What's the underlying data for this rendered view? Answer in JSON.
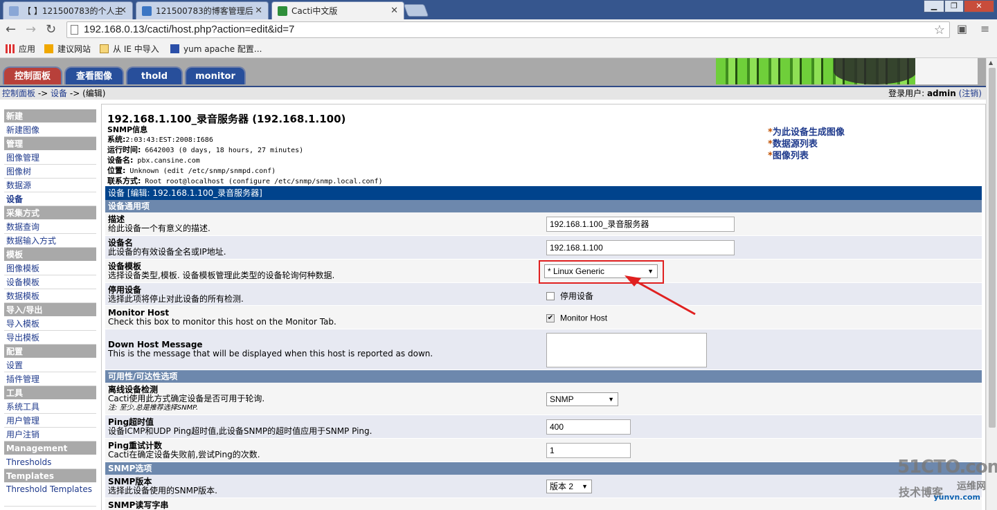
{
  "browser": {
    "tabs": [
      {
        "title": "【 】121500783的个人主",
        "active": false
      },
      {
        "title": "121500783的博客管理后",
        "active": false
      },
      {
        "title": "Cacti中文版",
        "active": true
      }
    ],
    "url": "192.168.0.13/cacti/host.php?action=edit&id=7",
    "bookmarks": [
      "应用",
      "建议网站",
      "从 IE 中导入",
      "yum apache 配置..."
    ]
  },
  "cacti": {
    "tabs": [
      "控制面板",
      "查看图像",
      "thold",
      "monitor"
    ],
    "breadcrumb": {
      "console": "控制面板",
      "sep1": " -> ",
      "devices": "设备",
      "sep2": " -> ",
      "current": "(编辑)"
    },
    "login": {
      "prefix": "登录用户: ",
      "user": "admin",
      "logout": "(注销)"
    }
  },
  "sidebar": [
    {
      "type": "header",
      "label": "新建"
    },
    {
      "type": "item",
      "label": "新建图像"
    },
    {
      "type": "header",
      "label": "管理"
    },
    {
      "type": "item",
      "label": "图像管理"
    },
    {
      "type": "item",
      "label": "图像树"
    },
    {
      "type": "item",
      "label": "数据源"
    },
    {
      "type": "item",
      "label": "设备",
      "current": true
    },
    {
      "type": "header",
      "label": "采集方式"
    },
    {
      "type": "item",
      "label": "数据查询"
    },
    {
      "type": "item",
      "label": "数据输入方式"
    },
    {
      "type": "header",
      "label": "模板"
    },
    {
      "type": "item",
      "label": "图像模板"
    },
    {
      "type": "item",
      "label": "设备模板"
    },
    {
      "type": "item",
      "label": "数据模板"
    },
    {
      "type": "header",
      "label": "导入/导出"
    },
    {
      "type": "item",
      "label": "导入模板"
    },
    {
      "type": "item",
      "label": "导出模板"
    },
    {
      "type": "header",
      "label": "配置"
    },
    {
      "type": "item",
      "label": "设置"
    },
    {
      "type": "item",
      "label": "插件管理"
    },
    {
      "type": "header",
      "label": "工具"
    },
    {
      "type": "item",
      "label": "系统工具"
    },
    {
      "type": "item",
      "label": "用户管理"
    },
    {
      "type": "item",
      "label": "用户注销"
    },
    {
      "type": "header",
      "label": "Management"
    },
    {
      "type": "item",
      "label": "Thresholds"
    },
    {
      "type": "header",
      "label": "Templates"
    },
    {
      "type": "item",
      "label": "Threshold Templates",
      "two_line": true
    }
  ],
  "device": {
    "title": "192.168.1.100_录音服务器 (192.168.1.100)",
    "snmp_info_label": "SNMP信息",
    "system_label": "系统:",
    "system_value": "2:03:43:EST:2008:I686",
    "uptime_label": "运行时间:",
    "uptime_value": " 6642003 (0 days, 18 hours, 27 minutes)",
    "hostname_label": "设备名:",
    "hostname_value": " pbx.cansine.com",
    "location_label": "位置:",
    "location_value": " Unknown (edit /etc/snmp/snmpd.conf)",
    "contact_label": "联系方式:",
    "contact_value": " Root root@localhost (configure /etc/snmp/snmp.local.conf)"
  },
  "quicklinks": [
    "为此设备生成图像",
    "数据源列表",
    "图像列表"
  ],
  "form": {
    "title": "设备 [编辑: 192.168.1.100_录音服务器]",
    "sec_general": "设备通用项",
    "desc_label": "描述",
    "desc_help": "给此设备一个有意义的描述.",
    "desc_value": "192.168.1.100_录音服务器",
    "hostname_label": "设备名",
    "hostname_help": "此设备的有效设备全名或IP地址.",
    "hostname_value": "192.168.1.100",
    "template_label": "设备模板",
    "template_help": "选择设备类型,模板. 设备模板管理此类型的设备轮询何种数据.",
    "template_value": "* Linux Generic",
    "disable_label": "停用设备",
    "disable_help": "选择此项将停止对此设备的所有检测.",
    "disable_check_label": "停用设备",
    "disable_checked": false,
    "monitor_label": "Monitor Host",
    "monitor_help": "Check this box to monitor this host on the Monitor Tab.",
    "monitor_check_label": "Monitor Host",
    "monitor_checked": true,
    "downmsg_label": "Down Host Message",
    "downmsg_help": "This is the message that will be displayed when this host is reported as down.",
    "sec_avail": "可用性/可达性选项",
    "detect_label": "离线设备检测",
    "detect_help": "Cacti使用此方式确定设备是否可用于轮询.",
    "detect_note": "注: 至少,总是推荐选择SNMP.",
    "detect_value": "SNMP",
    "ping_timeout_label": "Ping超时值",
    "ping_timeout_help": "设备ICMP和UDP Ping超时值,此设备SNMP的超时值应用于SNMP Ping.",
    "ping_timeout_value": "400",
    "ping_retry_label": "Ping重试计数",
    "ping_retry_help": "Cacti在确定设备失败前,尝试Ping的次数.",
    "ping_retry_value": "1",
    "sec_snmp": "SNMP选项",
    "snmp_ver_label": "SNMP版本",
    "snmp_ver_help": "选择此设备使用的SNMP版本.",
    "snmp_ver_value": "版本 2",
    "snmp_comm_label": "SNMP读写字串"
  },
  "watermark": {
    "site": "51CTO.com",
    "blog": "技术博客",
    "yw": "运维网",
    "domain": "yunvn.com"
  },
  "colors": {
    "title_bar": "#00438c",
    "section_bar": "#6d88ad",
    "highlight": "#e02020"
  }
}
